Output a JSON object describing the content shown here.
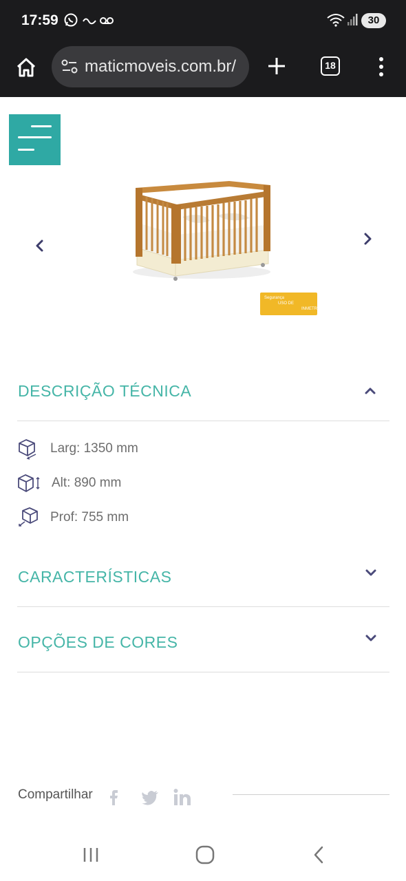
{
  "status_bar": {
    "time": "17:59",
    "battery": "30"
  },
  "browser": {
    "url": "maticmoveis.com.br/",
    "tab_count": "18"
  },
  "product": {
    "badge_lines": [
      "Segurança",
      "USO DE",
      "INMETRO"
    ]
  },
  "sections": {
    "technical": {
      "title": "DESCRIÇÃO TÉCNICA",
      "expanded": true,
      "specs": [
        {
          "icon": "width-box-icon",
          "label": "Larg: 1350 mm"
        },
        {
          "icon": "height-box-icon",
          "label": "Alt: 890 mm"
        },
        {
          "icon": "depth-box-icon",
          "label": "Prof: 755 mm"
        }
      ]
    },
    "features": {
      "title": "CARACTERÍSTICAS",
      "expanded": false
    },
    "colors": {
      "title": "OPÇÕES DE CORES",
      "expanded": false
    }
  },
  "share": {
    "label": "Compartilhar",
    "networks": [
      "facebook-icon",
      "twitter-icon",
      "linkedin-icon"
    ]
  },
  "theme": {
    "accent": "#2fa9a4",
    "heading": "#45b5a7",
    "chevron": "#4a4a7a",
    "chrome_bg": "#1b1b1d"
  }
}
